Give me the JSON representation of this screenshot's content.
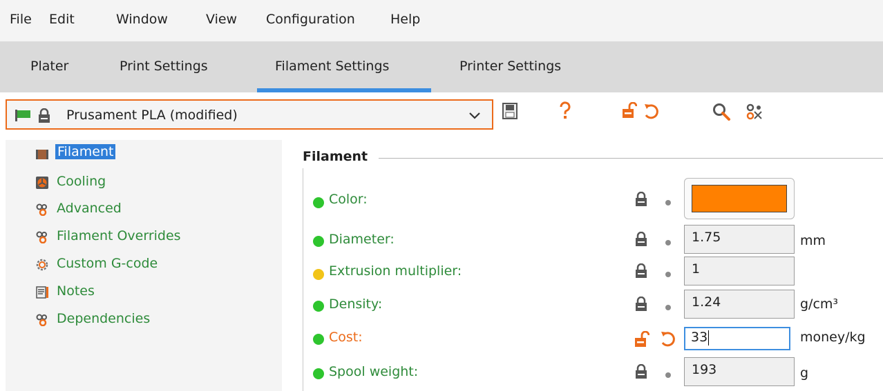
{
  "menu": [
    "File",
    "Edit",
    "Window",
    "View",
    "Configuration",
    "Help"
  ],
  "tabs": [
    "Plater",
    "Print Settings",
    "Filament Settings",
    "Printer Settings"
  ],
  "active_tab": "Filament Settings",
  "preset": {
    "name": "Prusament PLA (modified)",
    "icons": [
      "flag-icon",
      "lock-icon",
      "chevron-down-icon"
    ]
  },
  "toolbar_icons": [
    "save-icon",
    "question-icon",
    "unlocked-icon",
    "undo-icon",
    "search-icon",
    "compare-icon"
  ],
  "sidebar": {
    "items": [
      {
        "label": "Filament",
        "icon": "filament-icon",
        "selected": true
      },
      {
        "label": "Cooling",
        "icon": "fan-icon"
      },
      {
        "label": "Advanced",
        "icon": "gears-icon"
      },
      {
        "label": "Filament Overrides",
        "icon": "gears-icon"
      },
      {
        "label": "Custom G-code",
        "icon": "cog-icon"
      },
      {
        "label": "Notes",
        "icon": "note-icon"
      },
      {
        "label": "Dependencies",
        "icon": "gears-icon"
      }
    ]
  },
  "section": {
    "title": "Filament"
  },
  "params": [
    {
      "label": "Color:",
      "value": "",
      "unit": "",
      "swatch": "#ff8000",
      "status_color": "#2ec52e"
    },
    {
      "label": "Diameter:",
      "value": "1.75",
      "unit": "mm",
      "status_color": "#2ec52e"
    },
    {
      "label": "Extrusion multiplier:",
      "value": "1",
      "unit": "",
      "status_color": "#f2c418"
    },
    {
      "label": "Density:",
      "value": "1.24",
      "unit": "g/cm³",
      "status_color": "#2ec52e"
    },
    {
      "label": "Cost:",
      "value": "33",
      "unit": "money/kg",
      "status_color": "#2ec52e",
      "modified": true
    },
    {
      "label": "Spool weight:",
      "value": "193",
      "unit": "g",
      "status_color": "#2ec52e"
    }
  ],
  "colors": {
    "accent": "#ec6b1a",
    "green_label": "#2e8b3a",
    "selection": "#2f7ed8",
    "tab_underline": "#3d8ee0"
  }
}
